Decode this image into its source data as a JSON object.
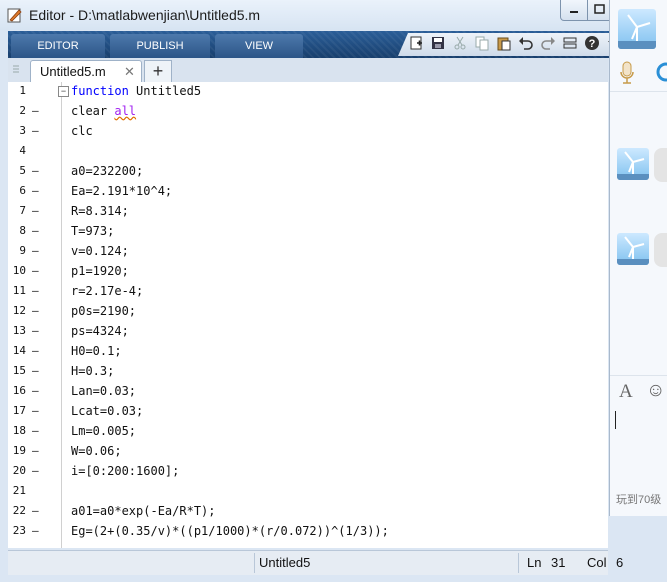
{
  "window": {
    "title": "Editor - D:\\matlabwenjian\\Untitled5.m"
  },
  "toolstrip": {
    "tabs": [
      {
        "label": "EDITOR"
      },
      {
        "label": "PUBLISH"
      },
      {
        "label": "VIEW"
      }
    ],
    "help_label": "?"
  },
  "editor": {
    "tab_label": "Untitled5.m",
    "close_glyph": "✕",
    "add_glyph": "+",
    "fold_glyph": "−",
    "lines": [
      {
        "n": "1",
        "mark": "",
        "kw": "function",
        "text": " Untitled5"
      },
      {
        "n": "2",
        "mark": "–",
        "text": "clear ",
        "warn": "all"
      },
      {
        "n": "3",
        "mark": "–",
        "text": "clc"
      },
      {
        "n": "4",
        "mark": "",
        "text": ""
      },
      {
        "n": "5",
        "mark": "–",
        "text": "a0=232200;"
      },
      {
        "n": "6",
        "mark": "–",
        "text": "Ea=2.191*10^4;"
      },
      {
        "n": "7",
        "mark": "–",
        "text": "R=8.314;"
      },
      {
        "n": "8",
        "mark": "–",
        "text": "T=973;"
      },
      {
        "n": "9",
        "mark": "–",
        "text": "v=0.124;"
      },
      {
        "n": "10",
        "mark": "–",
        "text": "p1=1920;"
      },
      {
        "n": "11",
        "mark": "–",
        "text": "r=2.17e-4;"
      },
      {
        "n": "12",
        "mark": "–",
        "text": "p0s=2190;"
      },
      {
        "n": "13",
        "mark": "–",
        "text": "ps=4324;"
      },
      {
        "n": "14",
        "mark": "–",
        "text": "H0=0.1;"
      },
      {
        "n": "15",
        "mark": "–",
        "text": "H=0.3;"
      },
      {
        "n": "16",
        "mark": "–",
        "text": "Lan=0.03;"
      },
      {
        "n": "17",
        "mark": "–",
        "text": "Lcat=0.03;"
      },
      {
        "n": "18",
        "mark": "–",
        "text": "Lm=0.005;"
      },
      {
        "n": "19",
        "mark": "–",
        "text": "W=0.06;"
      },
      {
        "n": "20",
        "mark": "–",
        "text": "i=[0:200:1600];"
      },
      {
        "n": "21",
        "mark": "",
        "text": ""
      },
      {
        "n": "22",
        "mark": "–",
        "text": "a01=a0*exp(-Ea/R*T);"
      },
      {
        "n": "23",
        "mark": "–",
        "text": "Eg=(2+(0.35/v)*((p1/1000)*(r/0.072))^(1/3));"
      }
    ]
  },
  "statusbar": {
    "script_name": "Untitled5",
    "ln_label": "Ln",
    "ln_value": "31",
    "col_label": "Col",
    "col_value": "6"
  },
  "side_panel": {
    "font_icon_glyph": "A",
    "emoji_glyph": "☺",
    "footer_text": "玩到70级"
  }
}
